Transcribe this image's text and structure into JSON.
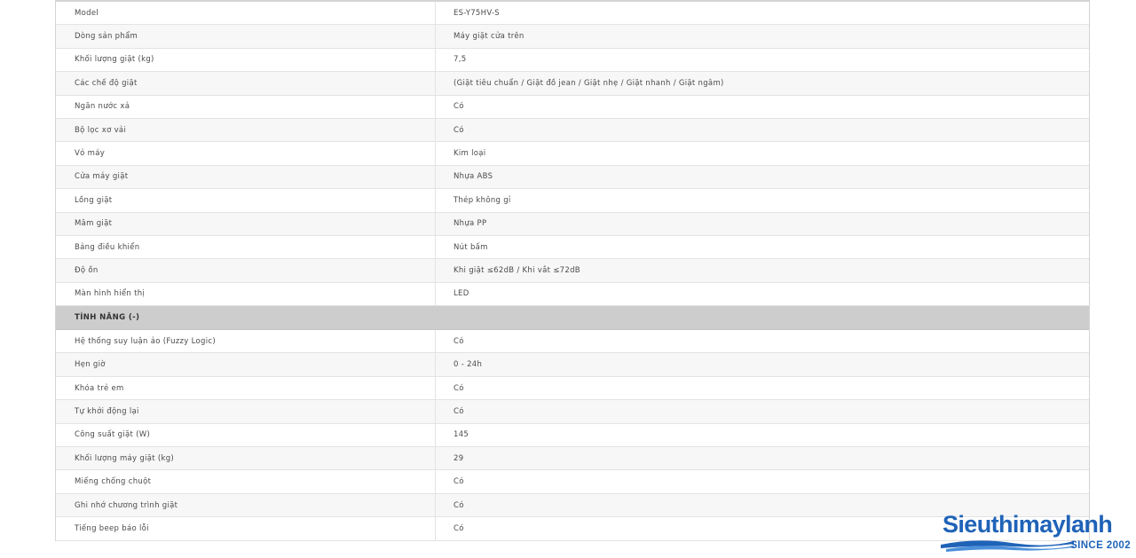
{
  "specs_top": [
    {
      "label": "Model",
      "value": "ES-Y75HV-S"
    },
    {
      "label": "Dòng sản phẩm",
      "value": "Máy giặt cửa trên"
    },
    {
      "label": "Khối lượng giặt (kg)",
      "value": "7,5"
    },
    {
      "label": "Các chế độ giặt",
      "value": "(Giặt tiêu chuẩn / Giặt đồ jean / Giặt nhẹ / Giặt nhanh / Giặt ngâm)"
    },
    {
      "label": "Ngăn nước xả",
      "value": "Có"
    },
    {
      "label": "Bộ lọc xơ vải",
      "value": "Có"
    },
    {
      "label": "Vỏ máy",
      "value": "Kim loại"
    },
    {
      "label": "Cửa máy giặt",
      "value": "Nhựa ABS"
    },
    {
      "label": "Lồng giặt",
      "value": "Thép không gỉ"
    },
    {
      "label": "Mâm giặt",
      "value": "Nhựa PP"
    },
    {
      "label": "Bảng điều khiển",
      "value": "Nút bấm"
    },
    {
      "label": "Độ ồn",
      "value": "Khi giặt ≤62dB / Khi vắt ≤72dB"
    },
    {
      "label": "Màn hình hiển thị",
      "value": "LED"
    }
  ],
  "section_features": {
    "title": "TÍNH NĂNG (-)"
  },
  "specs_features": [
    {
      "label": "Hệ thống suy luận ảo (Fuzzy Logic)",
      "value": "Có"
    },
    {
      "label": "Hẹn giờ",
      "value": "0 - 24h"
    },
    {
      "label": "Khóa trẻ em",
      "value": "Có"
    },
    {
      "label": "Tự khởi động lại",
      "value": "Có"
    },
    {
      "label": "Công suất giặt (W)",
      "value": "145"
    },
    {
      "label": "Khối lượng máy giặt (kg)",
      "value": "29"
    },
    {
      "label": "Miếng chống chuột",
      "value": "Có"
    },
    {
      "label": "Ghi nhớ chương trình giặt",
      "value": "Có"
    },
    {
      "label": "Tiếng beep báo lỗi",
      "value": "Có"
    }
  ],
  "watermark": {
    "brand": "Sieuthimaylanh",
    "since": "SINCE 2002"
  },
  "colors": {
    "brand_blue": "#1f63b8",
    "section_bg": "#cdcdcd"
  }
}
